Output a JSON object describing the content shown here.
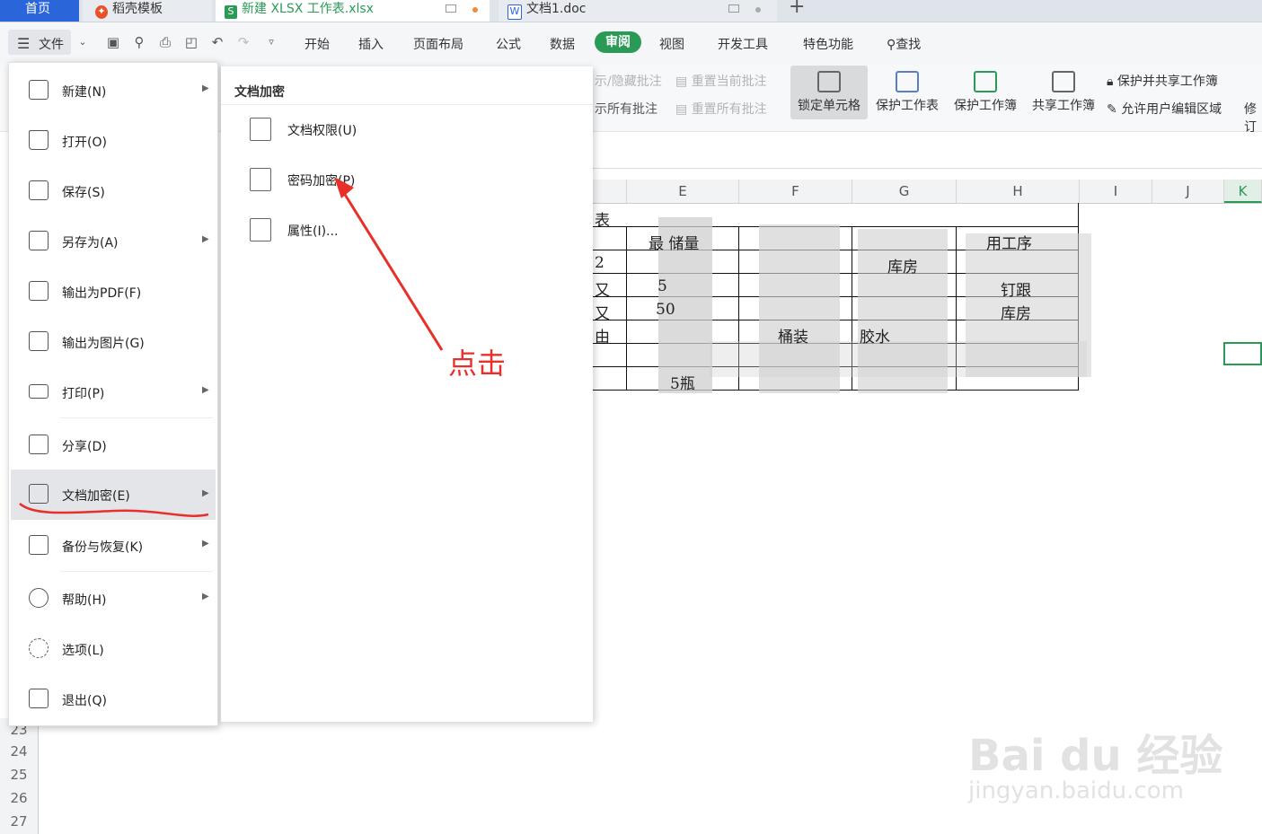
{
  "tabs": {
    "home": "首页",
    "daoke": "稻壳模板",
    "xlsx": "新建 XLSX 工作表.xlsx",
    "doc": "文档1.doc",
    "add": "+"
  },
  "menubar": {
    "file": "文件",
    "items": [
      "开始",
      "插入",
      "页面布局",
      "公式",
      "数据",
      "审阅",
      "视图",
      "开发工具",
      "特色功能"
    ],
    "search": "查找"
  },
  "ribbon": {
    "show_hide_comments": "示/隐藏批注",
    "show_all_comments": "示所有批注",
    "reset_current_comment": "重置当前批注",
    "reset_all_comments": "重置所有批注",
    "lock_cell": "锁定单元格",
    "protect_sheet": "保护工作表",
    "protect_workbook": "保护工作簿",
    "share_workbook": "共享工作簿",
    "protect_and_share": "保护并共享工作簿",
    "allow_edit_ranges": "允许用户编辑区域",
    "revise": "修订"
  },
  "sheet": {
    "columns": [
      "E",
      "F",
      "G",
      "H",
      "I",
      "J",
      "K"
    ],
    "rows": [
      "23",
      "24",
      "25",
      "26",
      "27"
    ],
    "cells": {
      "title_fragment": "表",
      "storage_header": "最  储量",
      "process_header": "  用工序",
      "r2a": "2",
      "warehouse": "库房",
      "r3a": "又",
      "r3e": "5",
      "nail": "钉跟",
      "r4a": "又",
      "r4e": "50",
      "r4h": "  库房",
      "r5a": "由",
      "barrel": "桶装",
      "glue": "胶水  ",
      "five_bottles": "5瓶"
    }
  },
  "file_menu": {
    "items": [
      {
        "label": "新建(N)",
        "arrow": true
      },
      {
        "label": "打开(O)",
        "arrow": false
      },
      {
        "label": "保存(S)",
        "arrow": false
      },
      {
        "label": "另存为(A)",
        "arrow": true
      },
      {
        "label": "输出为PDF(F)",
        "arrow": false
      },
      {
        "label": "输出为图片(G)",
        "arrow": false
      },
      {
        "label": "打印(P)",
        "arrow": true
      },
      {
        "label": "分享(D)",
        "arrow": false
      },
      {
        "label": "文档加密(E)",
        "arrow": true
      },
      {
        "label": "备份与恢复(K)",
        "arrow": true
      },
      {
        "label": "帮助(H)",
        "arrow": true
      },
      {
        "label": "选项(L)",
        "arrow": false
      },
      {
        "label": "退出(Q)",
        "arrow": false
      }
    ]
  },
  "submenu": {
    "title": "文档加密",
    "items": [
      "文档权限(U)",
      "密码加密(P)",
      "属性(I)..."
    ]
  },
  "annotation": {
    "click": "点击",
    "color": "#e8302a"
  },
  "watermark": {
    "logo": "Bai du 经验",
    "url": "jingyan.baidu.com"
  },
  "colors": {
    "accent_green": "#2c9a57",
    "home_tab_blue": "#2a66d9"
  }
}
